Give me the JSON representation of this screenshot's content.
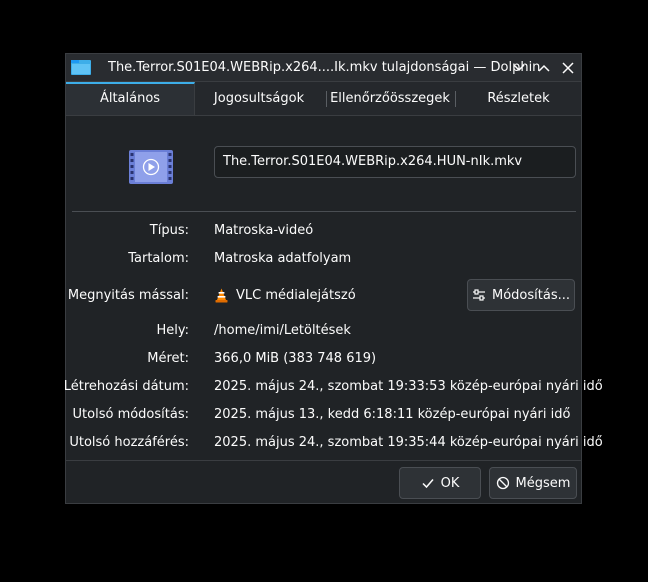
{
  "window": {
    "title": "The.Terror.S01E04.WEBRip.x264....Ik.mkv tulajdonságai — Dolphin"
  },
  "tabs": [
    {
      "label": "Általános"
    },
    {
      "label": "Jogosultságok"
    },
    {
      "label": "Ellenőrzőösszegek"
    },
    {
      "label": "Részletek"
    }
  ],
  "file": {
    "name": "The.Terror.S01E04.WEBRip.x264.HUN-nIk.mkv",
    "icon": "video-file-icon"
  },
  "properties": {
    "type_label": "Típus:",
    "type_value": "Matroska-videó",
    "content_label": "Tartalom:",
    "content_value": "Matroska adatfolyam",
    "open_with_label": "Megnyitás mással:",
    "open_with_value": "VLC médialejátszó",
    "change_button": "Módosítás...",
    "location_label": "Hely:",
    "location_value": "/home/imi/Letöltések",
    "size_label": "Méret:",
    "size_value": "366,0 MiB (383 748 619)",
    "created_label": "Létrehozási dátum:",
    "created_value": "2025. május 24., szombat 19:33:53 közép-európai nyári idő",
    "modified_label": "Utolsó módosítás:",
    "modified_value": "2025. május 13., kedd 6:18:11 közép-európai nyári idő",
    "accessed_label": "Utolsó hozzáférés:",
    "accessed_value": "2025. május 24., szombat 19:35:44 közép-európai nyári idő"
  },
  "buttons": {
    "ok": "OK",
    "cancel": "Mégsem"
  },
  "colors": {
    "accent": "#3daee9",
    "window_bg": "#202326"
  }
}
